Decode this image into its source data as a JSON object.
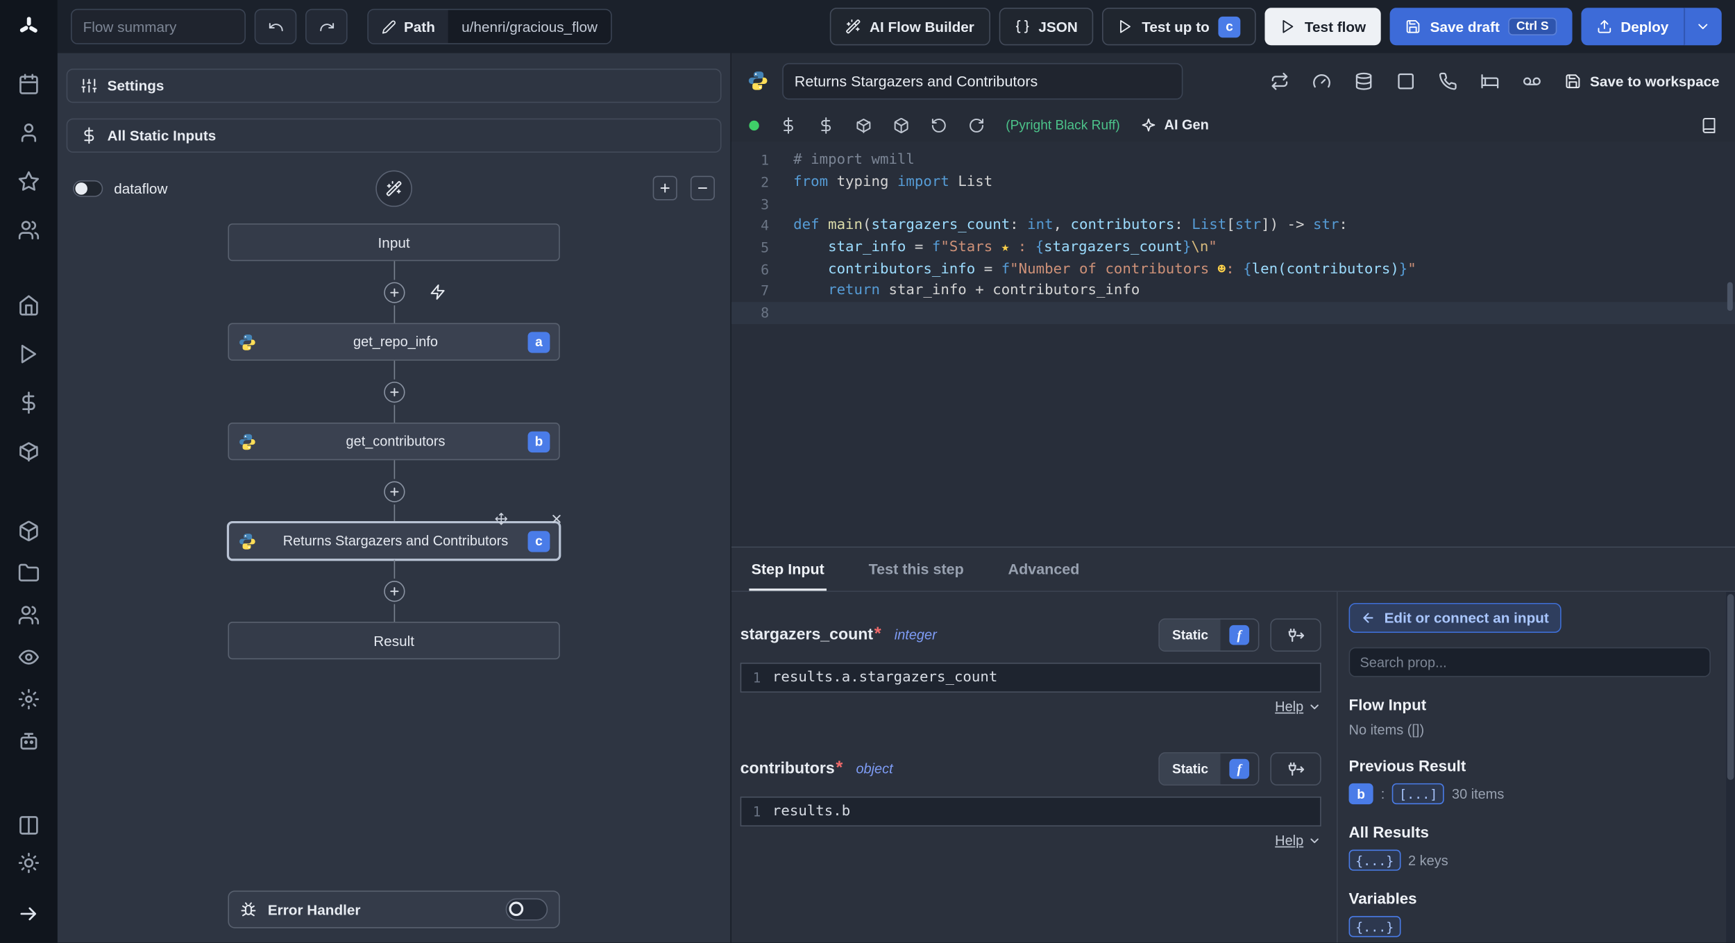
{
  "topbar": {
    "flow_summary_placeholder": "Flow summary",
    "path_label": "Path",
    "path_value": "u/henri/gracious_flow",
    "ai_flow_builder_label": "AI Flow Builder",
    "json_label": "JSON",
    "test_up_to_label": "Test up to",
    "test_up_to_badge": "c",
    "test_flow_label": "Test flow",
    "save_draft_label": "Save draft",
    "save_draft_shortcut": "Ctrl S",
    "deploy_label": "Deploy"
  },
  "flow": {
    "settings_label": "Settings",
    "all_static_inputs_label": "All Static Inputs",
    "dataflow_label": "dataflow",
    "input_label": "Input",
    "result_label": "Result",
    "steps": [
      {
        "name": "get_repo_info",
        "badge": "a"
      },
      {
        "name": "get_contributors",
        "badge": "b"
      },
      {
        "name": "Returns Stargazers and Contributors",
        "badge": "c"
      }
    ],
    "error_handler_label": "Error Handler"
  },
  "editor": {
    "title": "Returns Stargazers and Contributors",
    "save_to_workspace_label": "Save to workspace",
    "assistants_label": "(Pyright Black Ruff)",
    "ai_gen_label": "AI Gen",
    "language": "python",
    "lines": [
      {
        "num": 1,
        "toks": [
          [
            "c",
            "# import wmill"
          ]
        ]
      },
      {
        "num": 2,
        "toks": [
          [
            "k",
            "from"
          ],
          [
            "p",
            " typing "
          ],
          [
            "k",
            "import"
          ],
          [
            "p",
            " List"
          ]
        ]
      },
      {
        "num": 3,
        "toks": []
      },
      {
        "num": 4,
        "toks": [
          [
            "k",
            "def "
          ],
          [
            "f",
            "main"
          ],
          [
            "p",
            "("
          ],
          [
            "v",
            "stargazers_count"
          ],
          [
            "p",
            ": "
          ],
          [
            "k",
            "int"
          ],
          [
            "p",
            ", "
          ],
          [
            "v",
            "contributors"
          ],
          [
            "p",
            ": "
          ],
          [
            "k",
            "List"
          ],
          [
            "p",
            "["
          ],
          [
            "k",
            "str"
          ],
          [
            "p",
            "]) -> "
          ],
          [
            "k",
            "str"
          ],
          [
            "p",
            ":"
          ]
        ]
      },
      {
        "num": 5,
        "toks": [
          [
            "p",
            "    "
          ],
          [
            "v",
            "star_info"
          ],
          [
            "p",
            " = "
          ],
          [
            "k",
            "f"
          ],
          [
            "s",
            "\"Stars "
          ],
          [
            "em",
            "★"
          ],
          [
            "s",
            " : "
          ],
          [
            "b",
            "{"
          ],
          [
            "v",
            "stargazers_count"
          ],
          [
            "b",
            "}"
          ],
          [
            "e",
            "\\n"
          ],
          [
            "s",
            "\""
          ]
        ]
      },
      {
        "num": 6,
        "toks": [
          [
            "p",
            "    "
          ],
          [
            "v",
            "contributors_info"
          ],
          [
            "p",
            " = "
          ],
          [
            "k",
            "f"
          ],
          [
            "s",
            "\"Number of contributors "
          ],
          [
            "em",
            "☻"
          ],
          [
            "s",
            ": "
          ],
          [
            "b",
            "{"
          ],
          [
            "v",
            "len(contributors)"
          ],
          [
            "b",
            "}"
          ],
          [
            "s",
            "\""
          ]
        ]
      },
      {
        "num": 7,
        "toks": [
          [
            "p",
            "    "
          ],
          [
            "k",
            "return"
          ],
          [
            "p",
            " star_info + contributors_info"
          ]
        ]
      },
      {
        "num": 8,
        "toks": [],
        "current": true
      }
    ]
  },
  "step_panel": {
    "tabs": [
      {
        "label": "Step Input"
      },
      {
        "label": "Test this step"
      },
      {
        "label": "Advanced"
      }
    ],
    "fields": [
      {
        "name": "stargazers_count",
        "required_mark": "*",
        "type": "integer",
        "mode_label": "Static",
        "line_number": "1",
        "expression": "results.a.stargazers_count",
        "help_label": "Help"
      },
      {
        "name": "contributors",
        "required_mark": "*",
        "type": "object",
        "mode_label": "Static",
        "line_number": "1",
        "expression": "results.b",
        "help_label": "Help"
      }
    ]
  },
  "prop_panel": {
    "edit_connect_label": "Edit or connect an input",
    "search_placeholder": "Search prop...",
    "flow_input_title": "Flow Input",
    "flow_input_empty": "No items ([])",
    "previous_result_title": "Previous Result",
    "previous_result_badge": "b",
    "previous_result_separator": ":",
    "previous_result_collapsed": "[...]",
    "previous_result_count": "30 items",
    "all_results_title": "All Results",
    "all_results_collapsed": "{...}",
    "all_results_count": "2 keys",
    "variables_title": "Variables",
    "variables_collapsed": "{...}"
  },
  "colors": {
    "accent_blue": "#3d6bd8",
    "badge_blue": "#4a7ce8",
    "success_green": "#3fd068",
    "canvas_bg": "#2e3542",
    "sidebar_bg": "#10151d"
  },
  "sidebar_icons": [
    "windmill-logo",
    "calendar",
    "user",
    "star",
    "users",
    "home",
    "play",
    "dollar",
    "cube",
    "package",
    "folder",
    "group",
    "eye",
    "settings",
    "robot",
    "columns",
    "sun",
    "arrow-right"
  ]
}
